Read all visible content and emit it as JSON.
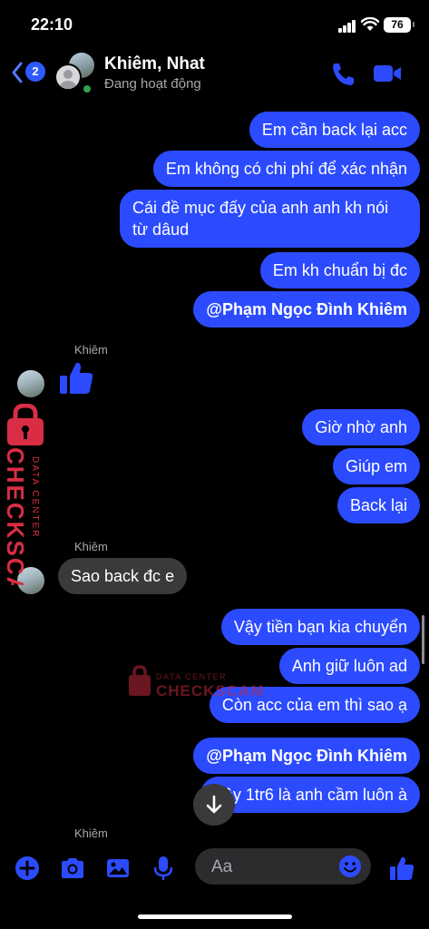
{
  "status_bar": {
    "time": "22:10",
    "battery": "76"
  },
  "header": {
    "unread_count": "2",
    "title": "Khiêm, Nhat",
    "subtitle": "Đang hoạt động"
  },
  "messages": [
    {
      "side": "out",
      "text": "Em cần back lại acc"
    },
    {
      "side": "out",
      "text": "Em không có chi phí để xác nhận"
    },
    {
      "side": "out",
      "text": "Cái đề mục đấy của anh anh kh nói từ dâud"
    },
    {
      "side": "out",
      "text": "Em kh chuẩn bị đc"
    },
    {
      "side": "out",
      "text": "@Phạm Ngọc Đình Khiêm"
    },
    {
      "side": "in",
      "sender": "Khiêm",
      "type": "like"
    },
    {
      "side": "out",
      "text": "Giờ nhờ anh"
    },
    {
      "side": "out",
      "text": "Giúp em"
    },
    {
      "side": "out",
      "text": "Back lại"
    },
    {
      "side": "in",
      "sender": "Khiêm",
      "text": "Sao back đc e"
    },
    {
      "side": "out",
      "text": "Vậy tiền bạn kia chuyển"
    },
    {
      "side": "out",
      "text": "Anh giữ luôn ad"
    },
    {
      "side": "out",
      "text": "Còn acc của em thì sao ạ"
    },
    {
      "side": "out",
      "text": "@Phạm Ngọc Đình Khiêm"
    },
    {
      "side": "out",
      "text": "Vậy 1tr6 là anh cầm luôn à"
    }
  ],
  "last_sender": "Khiêm",
  "watermark": {
    "brand": "CHECKSCAM.VN",
    "tagline": "DATA CENTER"
  },
  "composer": {
    "placeholder": "Aa"
  },
  "colors": {
    "accent": "#2c4bff",
    "incoming_bubble": "#3a3a3c",
    "background": "#000000",
    "online": "#31a24c"
  }
}
